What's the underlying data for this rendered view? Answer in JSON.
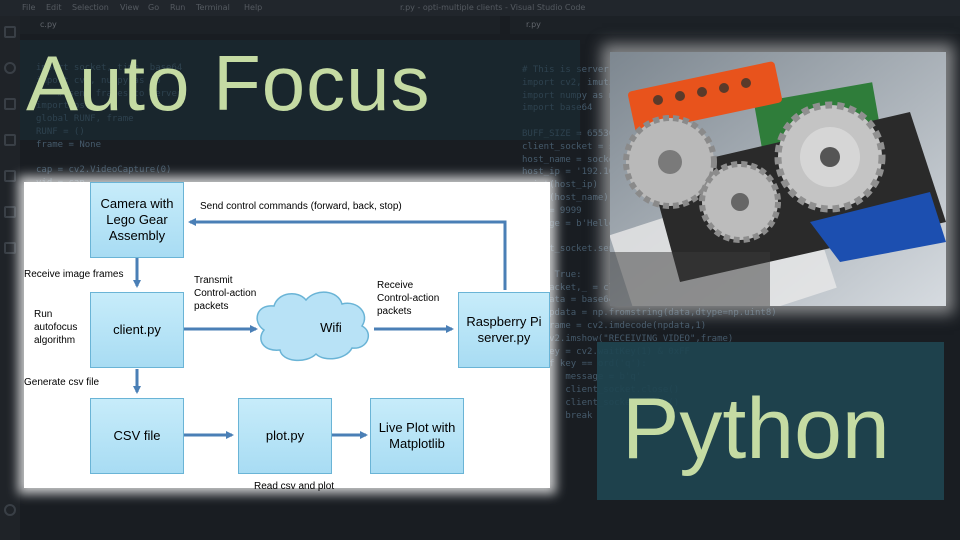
{
  "editor": {
    "menu": [
      "File",
      "Edit",
      "Selection",
      "View",
      "Go",
      "Run",
      "Terminal",
      "Help"
    ],
    "window_title": "r.py - opti-multiple clients - Visual Studio Code",
    "tab_left": "c.py",
    "tab_right": "r.py"
  },
  "title": "Auto Focus",
  "subtitle": "Python",
  "diagram": {
    "boxes": {
      "camera": "Camera with\nLego Gear\nAssembly",
      "client": "client.py",
      "raspberry": "Raspberry Pi\nserver.py",
      "csv": "CSV file",
      "plot": "plot.py",
      "live": "Live Plot with\nMatplotlib"
    },
    "cloud": "Wifi",
    "labels": {
      "send_control": "Send control commands (forward, back, stop)",
      "receive_frames": "Receive image frames",
      "transmit": "Transmit\nControl-action\npackets",
      "receive": "Receive\nControl-action\npackets",
      "run_autofocus": "Run\nautofocus\nalgorithm",
      "generate_csv": "Generate csv file",
      "read_csv": "Read csv and plot"
    }
  },
  "colors": {
    "title": "#c5dba3",
    "python_box": "#1e4450",
    "box_fill": "#b4e2f6",
    "arrow": "#4a7fb6"
  }
}
